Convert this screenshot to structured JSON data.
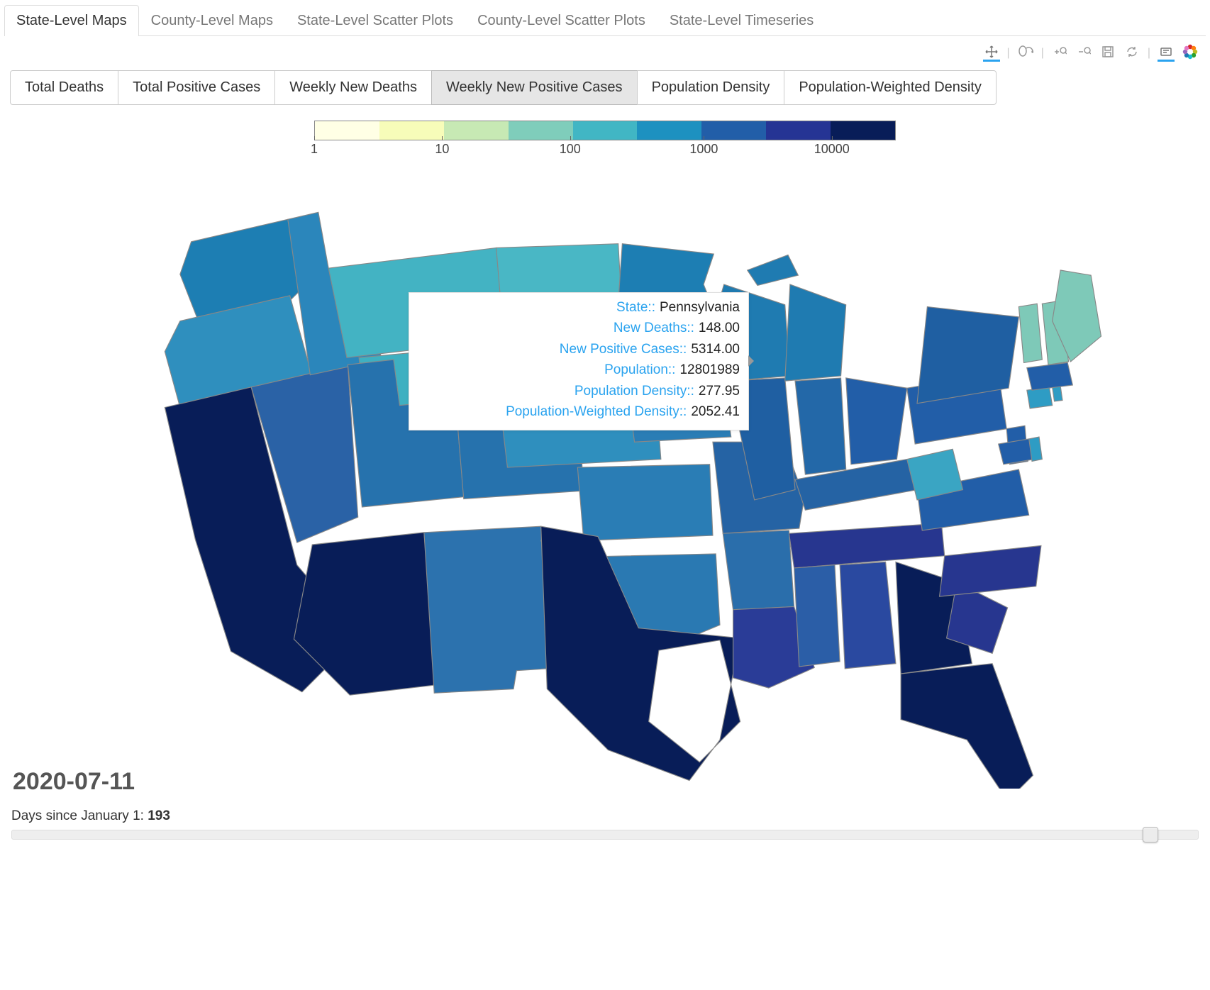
{
  "top_tabs": [
    {
      "label": "State-Level Maps",
      "active": true
    },
    {
      "label": "County-Level Maps",
      "active": false
    },
    {
      "label": "State-Level Scatter Plots",
      "active": false
    },
    {
      "label": "County-Level Scatter Plots",
      "active": false
    },
    {
      "label": "State-Level Timeseries",
      "active": false
    }
  ],
  "metric_buttons": [
    {
      "label": "Total Deaths",
      "active": false
    },
    {
      "label": "Total Positive Cases",
      "active": false
    },
    {
      "label": "Weekly New Deaths",
      "active": false
    },
    {
      "label": "Weekly New Positive Cases",
      "active": true
    },
    {
      "label": "Population Density",
      "active": false
    },
    {
      "label": "Population-Weighted Density",
      "active": false
    }
  ],
  "toolbar_icons": [
    "pan",
    "lasso",
    "zoom-in",
    "zoom-out",
    "save",
    "refresh",
    "hover",
    "bokeh-logo"
  ],
  "legend": {
    "colors": [
      "#ffffe5",
      "#f7fcb9",
      "#c7e9b4",
      "#7fcdbb",
      "#41b6c4",
      "#1d91c0",
      "#225ea8",
      "#253494",
      "#081d58"
    ],
    "ticks": [
      "1",
      "10",
      "100",
      "1000",
      "10000"
    ]
  },
  "date": "2020-07-11",
  "tooltip": {
    "rows": [
      {
        "k": "State::",
        "v": "Pennsylvania"
      },
      {
        "k": "New Deaths::",
        "v": "148.00"
      },
      {
        "k": "New Positive Cases::",
        "v": "5314.00"
      },
      {
        "k": "Population::",
        "v": "12801989"
      },
      {
        "k": "Population Density::",
        "v": "277.95"
      },
      {
        "k": "Population-Weighted Density::",
        "v": "2052.41"
      }
    ]
  },
  "slider": {
    "label": "Days since January 1:",
    "value": "193",
    "pos_pct": 96
  },
  "chart_data": {
    "type": "choropleth_map",
    "region": "United States (contiguous)",
    "metric": "Weekly New Positive Cases",
    "color_scale": "log",
    "scale_ticks": [
      1,
      10,
      100,
      1000,
      10000
    ],
    "date": "2020-07-11",
    "hover_state": "Pennsylvania",
    "hover_values": {
      "new_deaths": 148.0,
      "new_positive_cases": 5314.0,
      "population": 12801989,
      "population_density": 277.95,
      "population_weighted_density": 2052.41
    },
    "approx_colors": {
      "very_high_10000+": [
        "California",
        "Texas",
        "Florida",
        "Arizona",
        "Georgia"
      ],
      "high_3000_10000": [
        "Tennessee",
        "North Carolina",
        "South Carolina",
        "Louisiana",
        "Alabama",
        "Nevada",
        "Ohio",
        "Pennsylvania",
        "New York",
        "New Jersey",
        "Michigan",
        "Illinois",
        "Virginia",
        "Washington",
        "Missouri"
      ],
      "mid_300_3000": [
        "Oregon",
        "Idaho",
        "Utah",
        "Colorado",
        "New Mexico",
        "Oklahoma",
        "Kansas",
        "Nebraska",
        "Iowa",
        "Minnesota",
        "Wisconsin",
        "Indiana",
        "Kentucky",
        "Arkansas",
        "Mississippi",
        "Maryland",
        "Delaware",
        "Massachusetts",
        "Connecticut",
        "Rhode Island"
      ],
      "low_30_300": [
        "Montana",
        "Wyoming",
        "North Dakota",
        "South Dakota",
        "West Virginia"
      ],
      "very_low_<30": [
        "Maine",
        "New Hampshire",
        "Vermont"
      ]
    }
  }
}
